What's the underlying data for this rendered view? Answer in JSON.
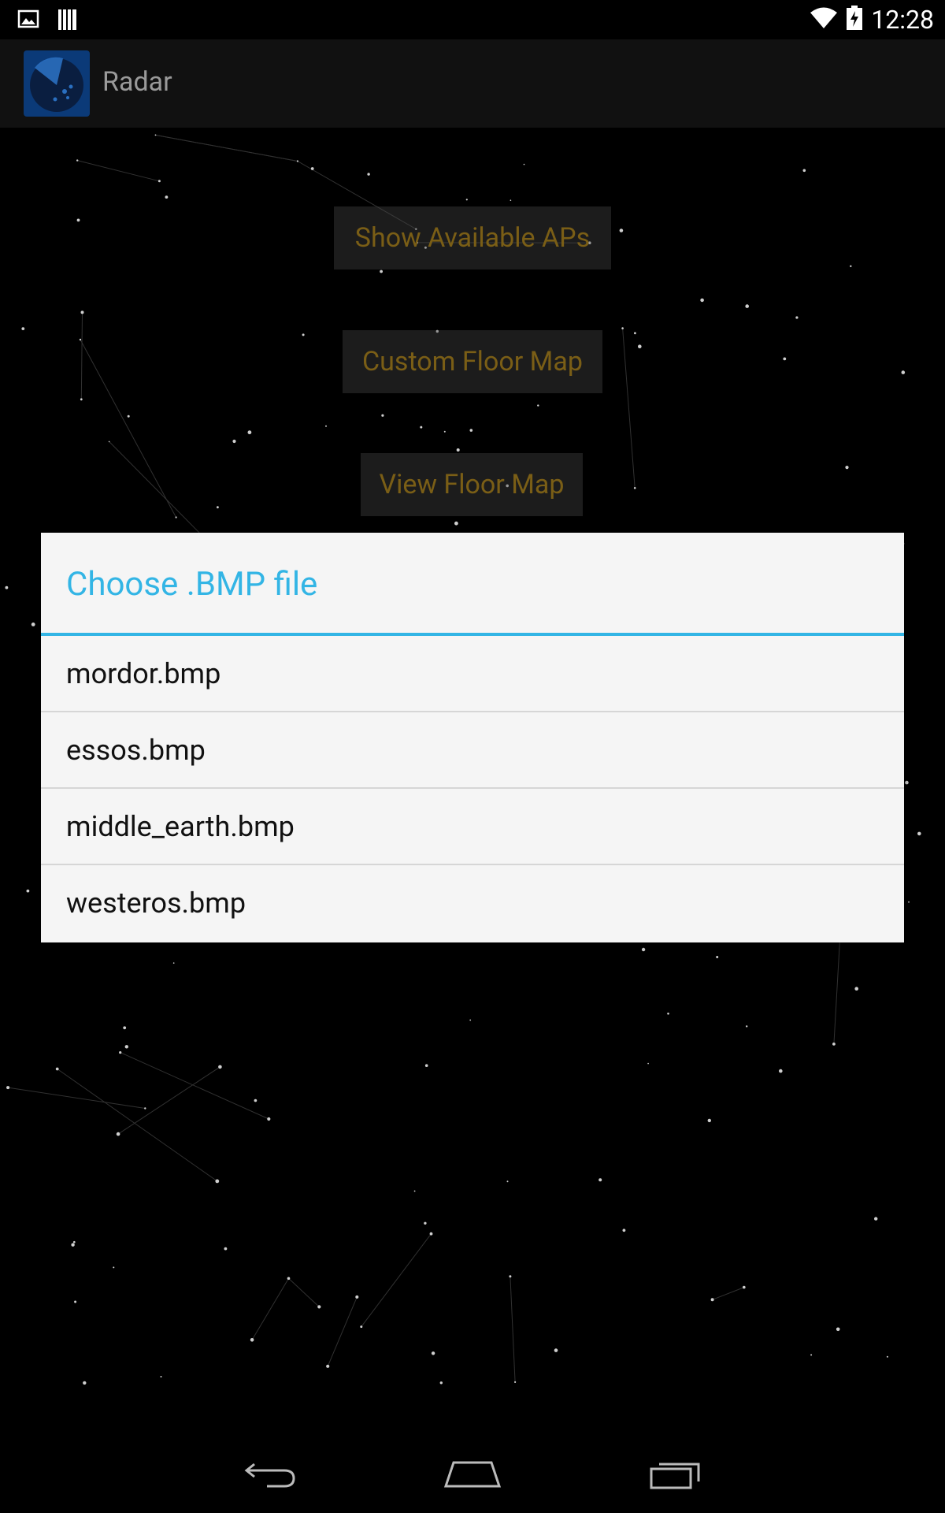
{
  "status_bar": {
    "time": "12:28",
    "left_icons": [
      "image-icon",
      "barcode-icon"
    ],
    "right_icons": [
      "wifi-icon",
      "battery-charging-icon"
    ]
  },
  "action_bar": {
    "title": "Radar",
    "app_icon": "radar-icon"
  },
  "main": {
    "buttons": [
      {
        "label": "Show Available APs"
      },
      {
        "label": "Custom Floor Map"
      },
      {
        "label": "View Floor Map"
      }
    ]
  },
  "dialog": {
    "title": "Choose .BMP file",
    "files": [
      "mordor.bmp",
      "essos.bmp",
      "middle_earth.bmp",
      "westeros.bmp"
    ]
  },
  "nav_bar": {
    "icons": [
      "back-icon",
      "home-icon",
      "recents-icon"
    ]
  },
  "colors": {
    "accent": "#33b5e5",
    "button_text": "#7a5e16",
    "dialog_bg": "#f5f5f5"
  }
}
